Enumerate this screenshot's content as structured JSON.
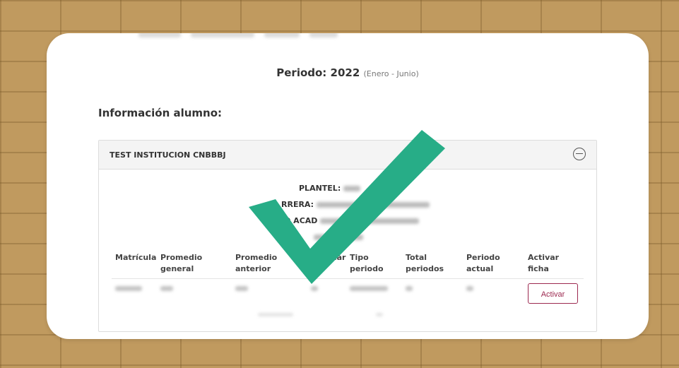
{
  "period": {
    "label": "Periodo: 2022",
    "range": "(Enero - Junio)"
  },
  "section_title": "Información alumno:",
  "institution": "TEST INSTITUCION CNBBBJ",
  "info": {
    "plantel_label": "PLANTEL:",
    "carrera_label": "RRERA:",
    "academico_label": "O ACAD"
  },
  "table": {
    "headers": [
      {
        "line1": "",
        "line2": "Matrícula"
      },
      {
        "line1": "Promedio",
        "line2": "general"
      },
      {
        "line1": "Promedio",
        "line2": "anterior"
      },
      {
        "line1": "",
        "line2": "ular"
      },
      {
        "line1": "Tipo",
        "line2": "periodo"
      },
      {
        "line1": "Total",
        "line2": "periodos"
      },
      {
        "line1": "Periodo",
        "line2": "actual"
      },
      {
        "line1": "Activar",
        "line2": "ficha"
      }
    ],
    "action_label": "Activar"
  },
  "colors": {
    "check": "#27ad87",
    "accent": "#9c2950",
    "background": "#c09a5f"
  },
  "icons": {
    "collapse": "minus-circle-icon",
    "overlay": "checkmark-icon"
  }
}
